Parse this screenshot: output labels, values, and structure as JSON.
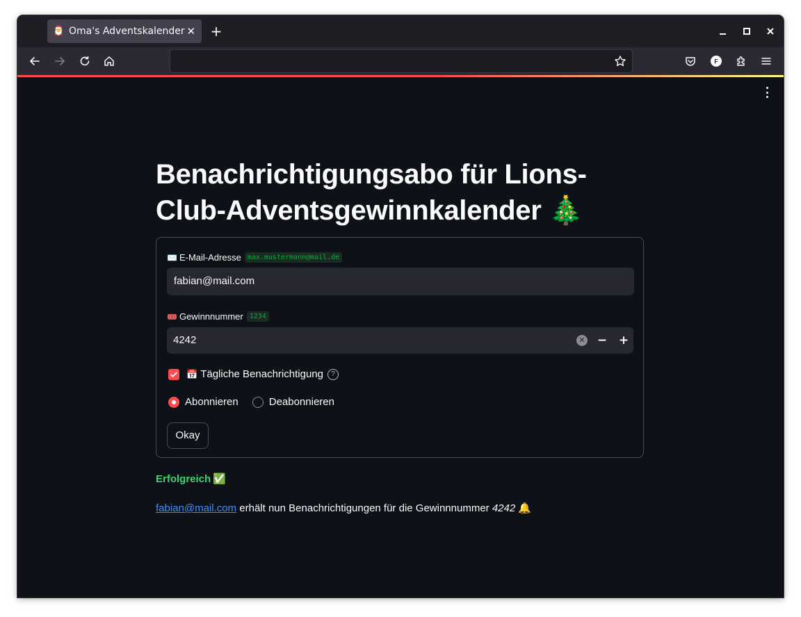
{
  "browser": {
    "tab_favicon": "🎅",
    "tab_title": "Oma's Adventskalender",
    "tab_close": "✕",
    "new_tab": "+",
    "url": ""
  },
  "page": {
    "title": "Benachrichtigungsabo für Lions-Club-Adventsgewinnkalender 🎄",
    "accent_color": "#ff4b4b",
    "background_color": "#0e1117"
  },
  "form": {
    "email": {
      "emoji": "✉️",
      "label": "E-Mail-Adresse",
      "example": "max.mustermann@mail.de",
      "value": "fabian@mail.com"
    },
    "number": {
      "emoji": "🎟️",
      "label": "Gewinnnummer",
      "example": "1234",
      "value": "4242",
      "clear": "✕",
      "minus": "−",
      "plus": "+"
    },
    "daily": {
      "checked": true,
      "emoji": "📅",
      "label": "Tägliche Benachrichtigung",
      "help": "?"
    },
    "radio": {
      "options": [
        "Abonnieren",
        "Deabonnieren"
      ],
      "selected": "Abonnieren"
    },
    "submit_label": "Okay"
  },
  "result": {
    "status": "Erfolgreich",
    "status_emoji": "✅",
    "email_link": "fabian@mail.com",
    "message": " erhält nun Benachrichtigungen für die Gewinnnummer ",
    "number": "4242",
    "bell": "🔔"
  }
}
